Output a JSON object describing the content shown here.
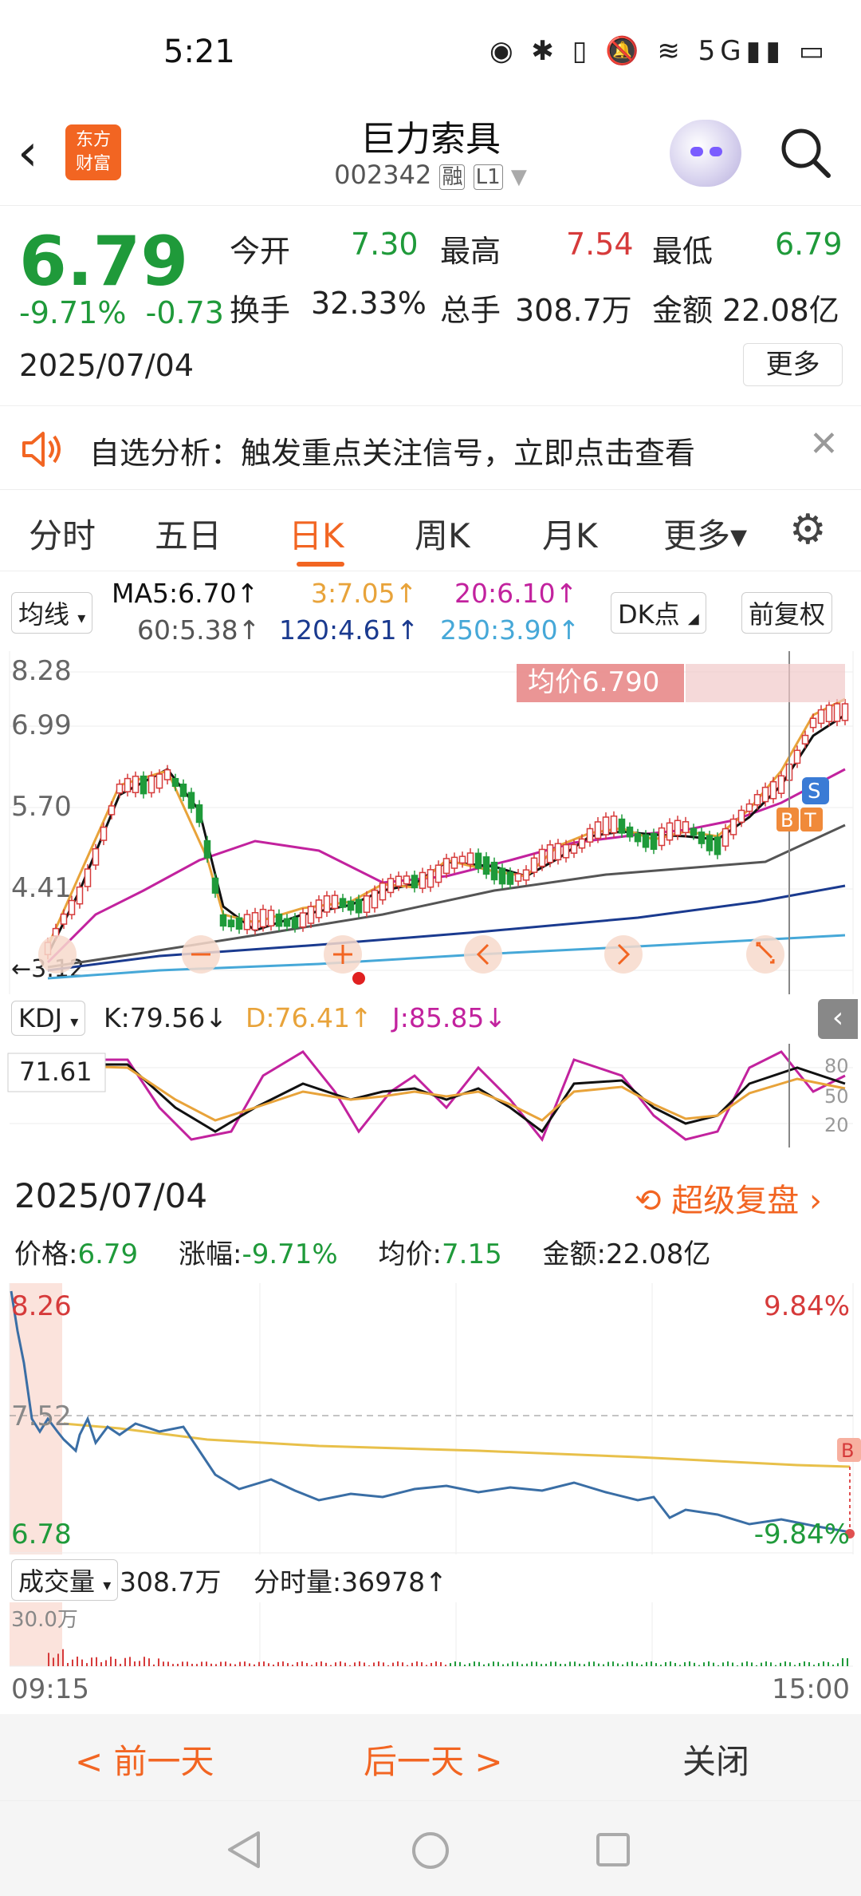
{
  "status_bar": {
    "time": "5:21",
    "icons_text": "◉ ✱ ▯ 🔕 ≋ 5G▮▮ ▭"
  },
  "header": {
    "back_icon": "chevron-left-icon",
    "logo_text_1": "东方",
    "logo_text_2": "财富",
    "stock_name": "巨力索具",
    "stock_code": "002342",
    "badge_rong": "融",
    "badge_level": "L1"
  },
  "quote": {
    "price": "6.79",
    "change_pct": "-9.71%",
    "change": "-0.73",
    "date": "2025/07/04",
    "open_label": "今开",
    "open": "7.30",
    "high_label": "最高",
    "high": "7.54",
    "low_label": "最低",
    "low": "6.79",
    "turnover_label": "换手",
    "turnover": "32.33%",
    "volume_label": "总手",
    "volume": "308.7万",
    "amount_label": "金额",
    "amount": "22.08亿",
    "more_label": "更多"
  },
  "alert": {
    "text": "自选分析：触发重点关注信号，立即点击查看",
    "close": "✕"
  },
  "tabs": [
    {
      "label": "分时"
    },
    {
      "label": "五日"
    },
    {
      "label": "日K",
      "active": true
    },
    {
      "label": "周K"
    },
    {
      "label": "月K"
    },
    {
      "label": "更多▾"
    }
  ],
  "ma_bar": {
    "dropdown": "均线",
    "ma5": "MA5:6.70↑",
    "ma3": "3:7.05↑",
    "ma20": "20:6.10↑",
    "ma60": "60:5.38↑",
    "ma120": "120:4.61↑",
    "ma250": "250:3.90↑",
    "dk_button": "DK点",
    "fq_button": "前复权",
    "colors": {
      "ma5": "#111111",
      "ma3": "#e8a33a",
      "ma20": "#c2229e",
      "ma60": "#555555",
      "ma120": "#1a3a8f",
      "ma250": "#46a8d8"
    }
  },
  "kline": {
    "y_labels": [
      "8.28",
      "6.99",
      "5.70",
      "4.41"
    ],
    "low_label": "3.12",
    "avg_price_tag": "均价6.790",
    "marker_s": "S",
    "marker_b": "B",
    "marker_t": "T"
  },
  "kdj": {
    "dropdown": "KDJ",
    "k": "K:79.56↓",
    "d": "D:76.41↑",
    "j": "J:85.85↓",
    "cursor_value": "71.61",
    "right_labels": [
      "80",
      "50",
      "20"
    ]
  },
  "detail": {
    "date": "2025/07/04",
    "replay_label": "超级复盘",
    "price_label": "价格:",
    "price": "6.79",
    "pct_label": "涨幅:",
    "pct": "-9.71%",
    "avg_label": "均价:",
    "avg": "7.15",
    "amount_label": "金额:",
    "amount": "22.08亿"
  },
  "timechart": {
    "top_left": "8.26",
    "mid_left": "7.52",
    "bottom_left": "6.78",
    "top_right": "9.84%",
    "bottom_right": "-9.84%",
    "marker": "B"
  },
  "volume": {
    "dropdown": "成交量",
    "total": "308.7万",
    "minute_label": "分时量:36978↑",
    "scale": "30.0万",
    "start_time": "09:15",
    "end_time": "15:00"
  },
  "bottom_bar": {
    "prev": "< 前一天",
    "next": "后一天 >",
    "close": "关闭"
  }
}
